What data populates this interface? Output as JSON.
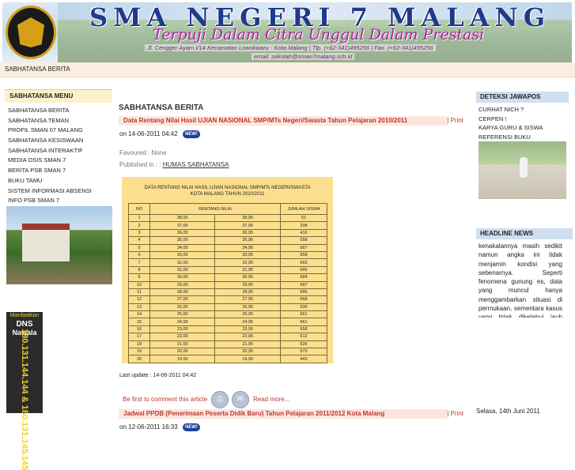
{
  "header": {
    "school_name": "SMA NEGERI 7 MALANG",
    "motto": "Terpuji Dalam Citra Unggul Dalam Prestasi",
    "address": "Jl. Cengger Ayam I/14 Kecamatan Lowokwaru - Kota Malang | Tlp. (+62-341)495256 | Fax. (+62-341)495256",
    "email": "email: sekolah@sman7malang.sch.id"
  },
  "breadcrumb": "SABHATANSA BERITA",
  "left_menu": {
    "heading": "SABHATANSA MENU",
    "items": [
      "SABHATANSA BERITA",
      "SABHATANSA TEMAN",
      "PROFIL SMAN 07 MALANG",
      "SABHATANSA KESISWAAN",
      "SABHATANSA INTERAKTIF",
      "MEDIA OSIS SMAN 7",
      "BERITA PSB SMAN 7",
      "BUKU TAMU",
      "SISTEM INFORMASI ABSENSI",
      "INFO PSB SMAN 7"
    ]
  },
  "dns_banner": {
    "line1": "Manfaatkan",
    "line2": "DNS",
    "line3": "Nawala",
    "numbers": "180.131.144.144 & 180.131.145.145"
  },
  "main": {
    "page_title": "SABHATANSA BERITA",
    "article1": {
      "title": "Data Rentang Nilai Hasil UJIAN NASIONAL SMP/MTs Negeri/Swasta Tahun Pelajaran 2010/2011",
      "print_sep": "|",
      "print_label": "Print",
      "date": "on 14-06-2011 04:42",
      "new_badge": "NEW!",
      "favoured": "Favoured : None",
      "published_label": "Published in : :",
      "published_link": "HUMAS SABHATANSA",
      "last_update": "Last update : 14-06-2011 04:42",
      "comment_link": "Be first to comment this article",
      "read_more": "Read more..."
    },
    "table": {
      "caption_line1": "DATA RENTANG NILAI HASIL UJIAN NASIONAL SMP/MTs NEGERI/SWASTA",
      "caption_line2": "KOTA MALANG TAHUN 2010/2011",
      "headers": [
        "NO",
        "RENTANG NILAI",
        "",
        "JUMLAH SISWA"
      ],
      "rows": [
        [
          "1",
          "38,00",
          "38,90",
          "51"
        ],
        [
          "2",
          "37,00",
          "37,95",
          "208"
        ],
        [
          "3",
          "36,00",
          "36,95",
          "416"
        ],
        [
          "4",
          "35,00",
          "35,95",
          "558"
        ],
        [
          "5",
          "34,00",
          "34,95",
          "567"
        ],
        [
          "6",
          "33,00",
          "33,95",
          "658"
        ],
        [
          "7",
          "32,00",
          "32,95",
          "663"
        ],
        [
          "8",
          "31,00",
          "31,95",
          "665"
        ],
        [
          "9",
          "30,00",
          "30,95",
          "684"
        ],
        [
          "10",
          "29,00",
          "29,95",
          "687"
        ],
        [
          "11",
          "28,00",
          "28,95",
          "695"
        ],
        [
          "12",
          "27,00",
          "27,95",
          "668"
        ],
        [
          "13",
          "26,00",
          "26,95",
          "630"
        ],
        [
          "14",
          "25,00",
          "25,95",
          "661"
        ],
        [
          "15",
          "24,00",
          "24,95",
          "661"
        ],
        [
          "16",
          "23,00",
          "23,95",
          "658"
        ],
        [
          "17",
          "22,00",
          "22,95",
          "612"
        ],
        [
          "18",
          "21,00",
          "21,95",
          "626"
        ],
        [
          "19",
          "20,00",
          "20,95",
          "573"
        ],
        [
          "20",
          "19,00",
          "19,95",
          "443"
        ]
      ]
    },
    "article2": {
      "title": "Jadwal PPDB (Penerimaan Peserta Didik Baru) Tahun Pelajaran 2011/2012 Kota Malang",
      "print_sep": "|",
      "print_label": "Print",
      "date": "on 12-06-2011 16:33",
      "new_badge": "NEW!"
    }
  },
  "right": {
    "jawapos_heading": "DETEKSI JAWAPOS",
    "jawapos_items": [
      "CURHAT NICH ?",
      "CERPEN !",
      "KARYA GURU & SISWA",
      "REFERENSI BUKU"
    ],
    "headline_heading": "HEADLINE NEWS",
    "headline_text": "kenakalannya masih sedikit namun angka ini tidak menjamin kondisi yang sebenarnya. Seperti fenomena gunung es, data yang muncul hanya menggambarkan situasi di permukaan, sementara kasus yang tidak diketahui jauh lebih",
    "date": "Selasa, 14th Juni 2011"
  }
}
